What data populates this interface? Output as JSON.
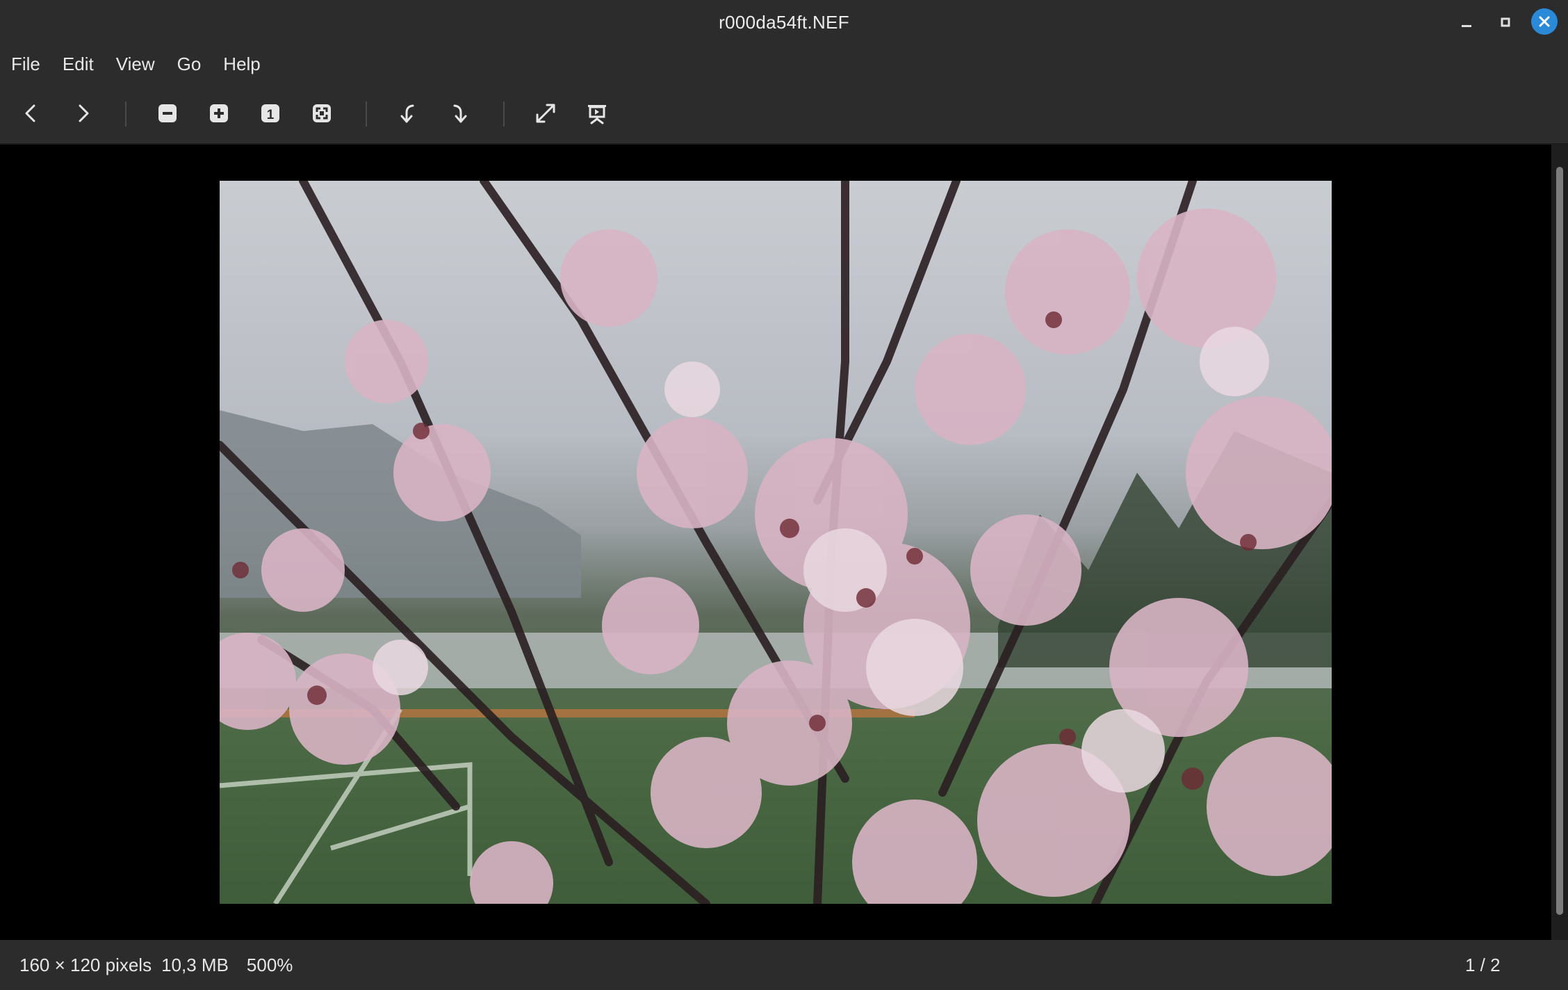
{
  "window": {
    "title": "r000da54ft.NEF"
  },
  "menu": [
    "File",
    "Edit",
    "View",
    "Go",
    "Help"
  ],
  "toolbar": {
    "buttons": [
      "previous-icon",
      "next-icon",
      "zoom-out-icon",
      "zoom-in-icon",
      "zoom-100-icon",
      "zoom-fit-icon",
      "rotate-left-icon",
      "rotate-right-icon",
      "fullscreen-icon",
      "slideshow-icon"
    ],
    "zoom_100_glyph": "1"
  },
  "status": {
    "dimensions": "160 × 120 pixels",
    "filesize": "10,3 MB",
    "zoom": "500%",
    "position": "1 / 2"
  },
  "colors": {
    "chrome": "#2c2c2c",
    "accent": "#2a8ad8",
    "background": "#000000"
  }
}
